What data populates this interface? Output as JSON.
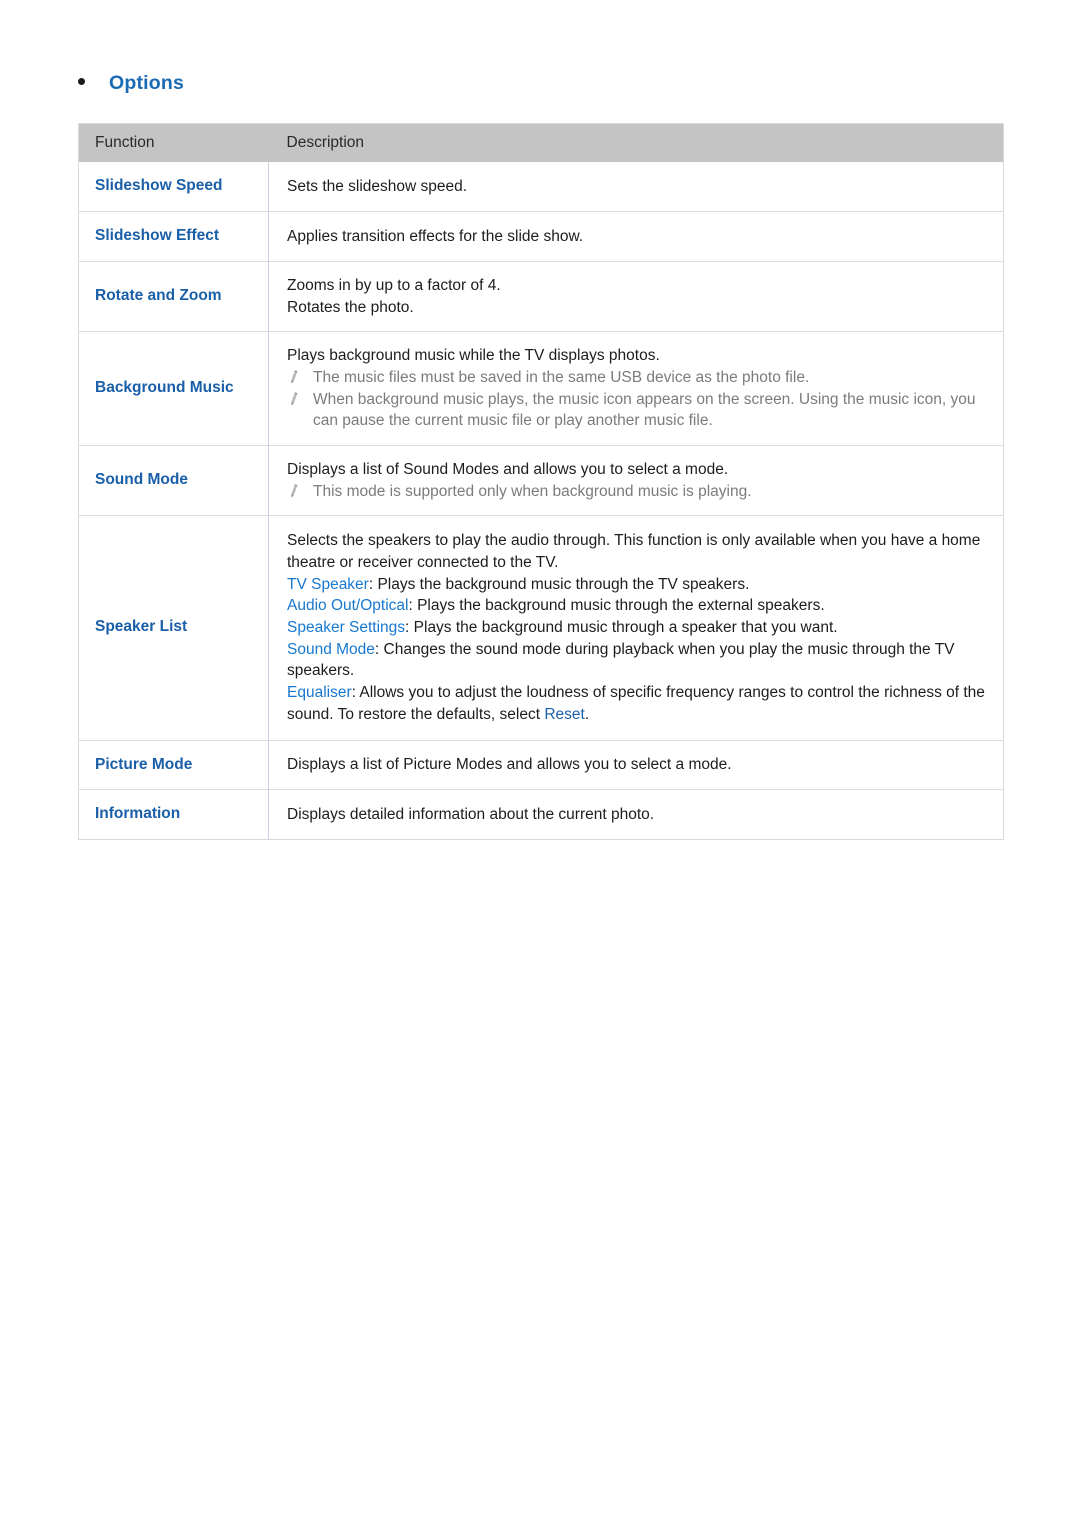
{
  "heading": {
    "bullet": "•",
    "title": "Options"
  },
  "table": {
    "columns": [
      "Function",
      "Description"
    ],
    "rows": [
      {
        "function": "Slideshow Speed",
        "lines": [
          {
            "type": "plain",
            "text": "Sets the slideshow speed."
          }
        ]
      },
      {
        "function": "Slideshow Effect",
        "lines": [
          {
            "type": "plain",
            "text": "Applies transition effects for the slide show."
          }
        ]
      },
      {
        "function": "Rotate and Zoom",
        "lines": [
          {
            "type": "plain",
            "text": "Zooms in by up to a factor of 4."
          },
          {
            "type": "plain",
            "text": "Rotates the photo."
          }
        ]
      },
      {
        "function": "Background Music",
        "lines": [
          {
            "type": "plain",
            "text": "Plays background music while the TV displays photos."
          },
          {
            "type": "note",
            "text": "The music files must be saved in the same USB device as the photo file."
          },
          {
            "type": "note",
            "text": "When background music plays, the music icon appears on the screen. Using the music icon, you can pause the current music file or play another music file."
          }
        ]
      },
      {
        "function": "Sound Mode",
        "lines": [
          {
            "type": "plain",
            "text": "Displays a list of Sound Modes and allows you to select a mode."
          },
          {
            "type": "note",
            "text": "This mode is supported only when background music is playing."
          }
        ]
      },
      {
        "function": "Speaker List",
        "lines": [
          {
            "type": "plain",
            "text": "Selects the speakers to play the audio through. This function is only available when you have a home theatre or receiver connected to the TV."
          },
          {
            "type": "term",
            "term": "TV Speaker",
            "text": ": Plays the background music through the TV speakers."
          },
          {
            "type": "term",
            "term": "Audio Out/Optical",
            "text": ": Plays the background music through the external speakers."
          },
          {
            "type": "term",
            "term": "Speaker Settings",
            "text": ": Plays the background music through a speaker that you want."
          },
          {
            "type": "term",
            "term": "Sound Mode",
            "text": ": Changes the sound mode during playback when you play the music through the TV speakers."
          },
          {
            "type": "term-trailing",
            "term": "Equaliser",
            "text": ": Allows you to adjust the loudness of specific frequency ranges to control the richness of the sound. To restore the defaults, select ",
            "trailing_link": "Reset",
            "tail": "."
          }
        ]
      },
      {
        "function": "Picture Mode",
        "lines": [
          {
            "type": "plain",
            "text": "Displays a list of Picture Modes and allows you to select a mode."
          }
        ]
      },
      {
        "function": "Information",
        "lines": [
          {
            "type": "plain",
            "text": "Displays detailed information about the current photo."
          }
        ]
      }
    ]
  },
  "colors": {
    "heading_blue": "#1a6bb3",
    "function_blue": "#1a5fa8",
    "term_blue": "#1878cf",
    "header_gray": "#c4c4c4",
    "note_gray": "#7b7b7b",
    "body_text": "#1d1d1d",
    "border": "#dcdcdc"
  },
  "icons": {
    "note": "pencil-icon"
  }
}
